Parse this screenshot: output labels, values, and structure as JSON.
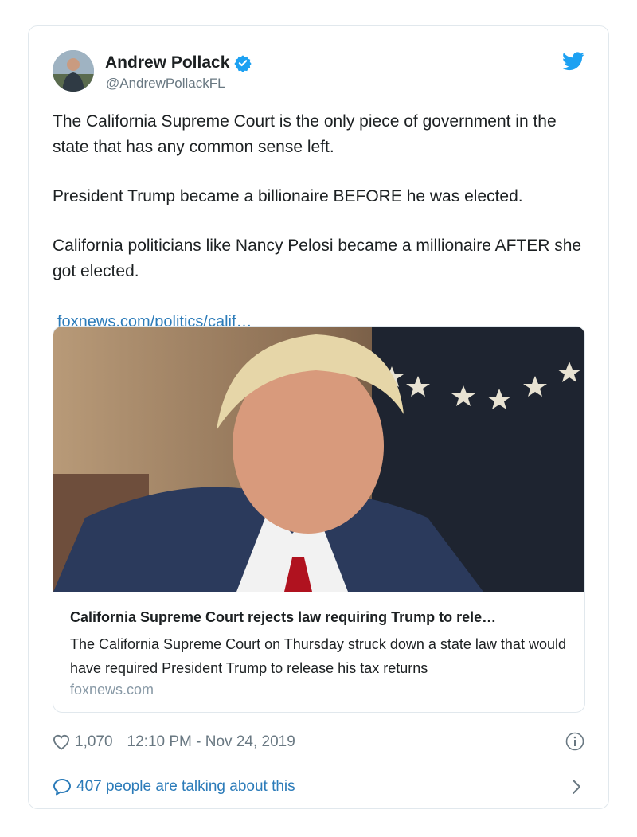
{
  "author": {
    "display_name": "Andrew Pollack",
    "handle": "@AndrewPollackFL",
    "verified": true
  },
  "tweet": {
    "paragraphs": [
      "The California Supreme Court is the only piece of government in the state that has any common sense left.",
      "President Trump became a billionaire BEFORE he was elected.",
      "California politicians like Nancy Pelosi became a millionaire AFTER she got elected."
    ],
    "link_text": "foxnews.com/politics/calif…"
  },
  "card": {
    "title": "California Supreme Court rejects law requiring Trump to rele…",
    "description": "The California Supreme Court on Thursday struck down a state law that would have required President Trump to release his tax returns",
    "domain": "foxnews.com"
  },
  "meta": {
    "like_count": "1,070",
    "timestamp": "12:10 PM - Nov 24, 2019"
  },
  "conversation": {
    "label": "407 people are talking about this"
  },
  "icons": {
    "verified": "verified-badge-icon",
    "twitter": "twitter-bird-icon",
    "heart": "heart-icon",
    "info": "info-icon",
    "reply": "speech-bubble-icon",
    "chevron": "chevron-right-icon"
  },
  "colors": {
    "link": "#2b7bb9",
    "twitter_blue": "#1da1f2",
    "secondary_text": "#697882",
    "border": "#e1e8ed"
  }
}
